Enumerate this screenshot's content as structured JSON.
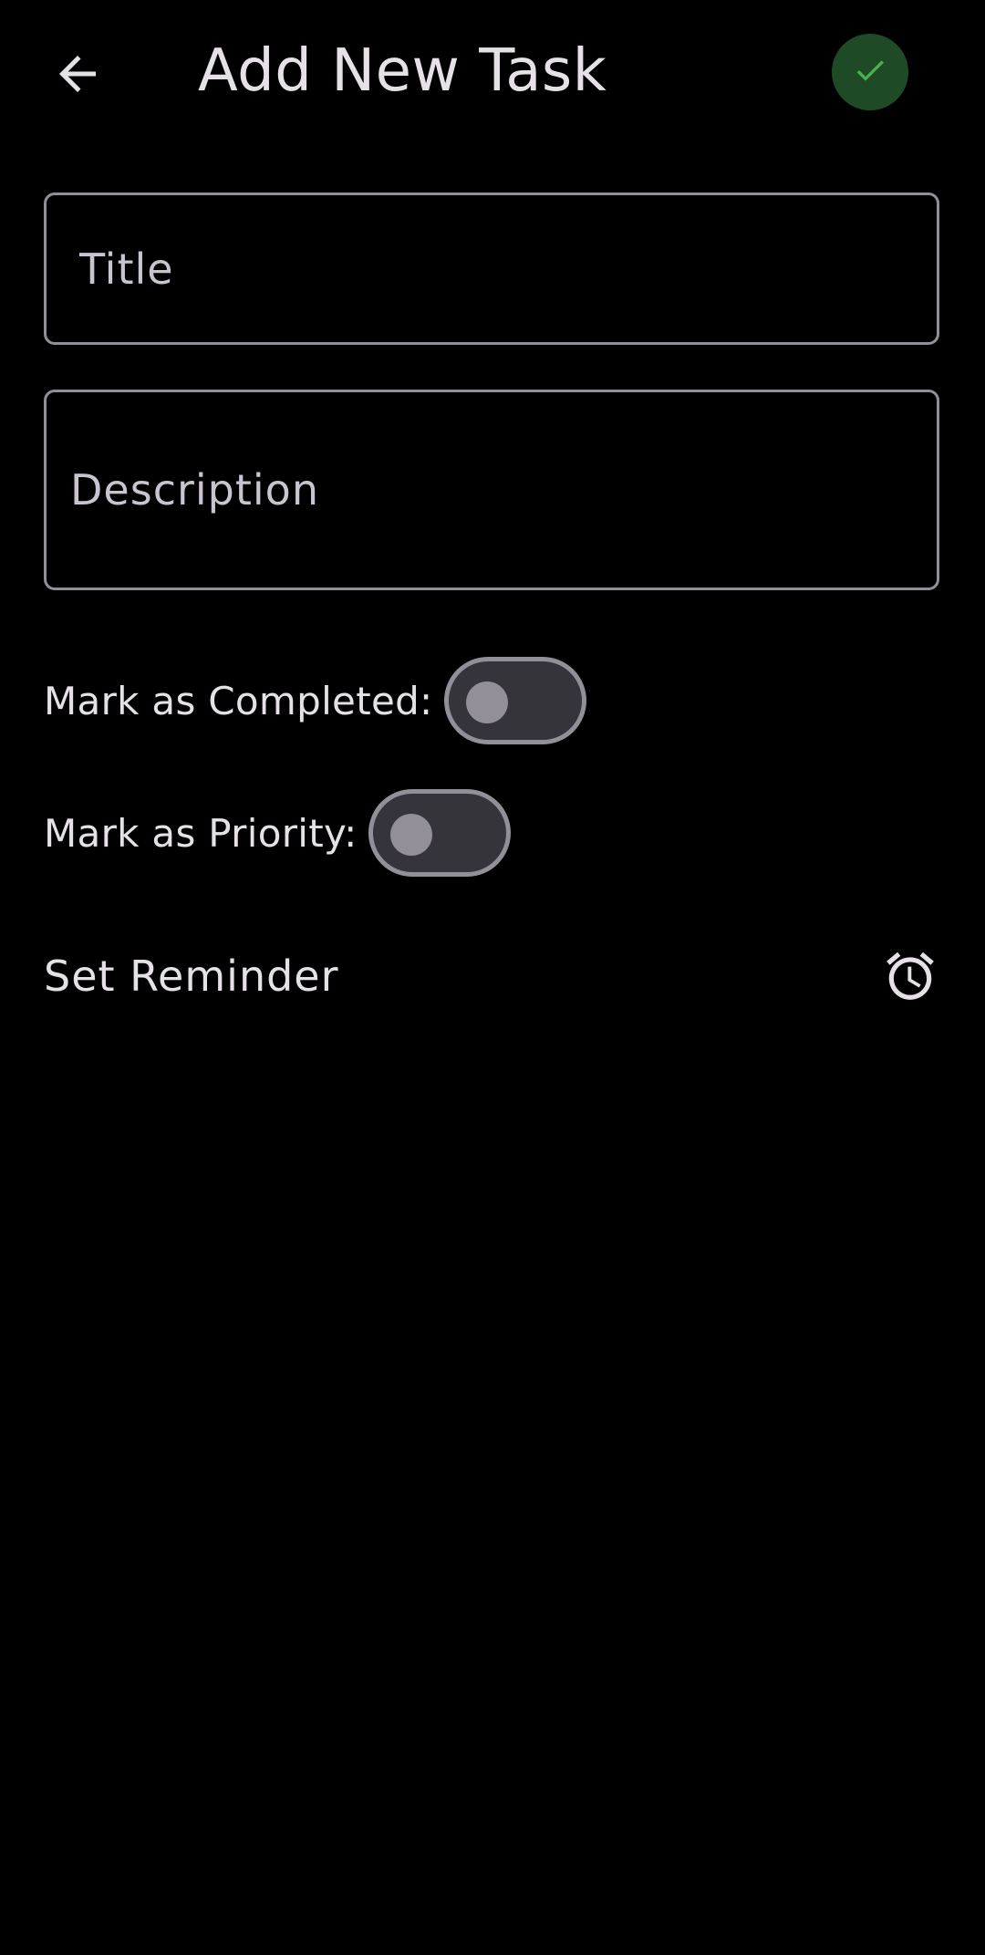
{
  "header": {
    "title": "Add New Task",
    "back_icon": "arrow-back-icon",
    "save_icon": "check-icon"
  },
  "form": {
    "title_placeholder": "Title",
    "title_value": "",
    "description_placeholder": "Description",
    "description_value": ""
  },
  "toggles": [
    {
      "label": "Mark as Completed:",
      "on": false
    },
    {
      "label": "Mark as Priority:",
      "on": false
    }
  ],
  "reminder": {
    "label": "Set Reminder",
    "icon": "alarm-clock-icon"
  },
  "colors": {
    "background": "#000000",
    "text": "#e6e1e6",
    "outline": "#938f99",
    "save_bg": "#1f4a26",
    "save_check": "#4caf50",
    "switch_track": "#36343b"
  }
}
